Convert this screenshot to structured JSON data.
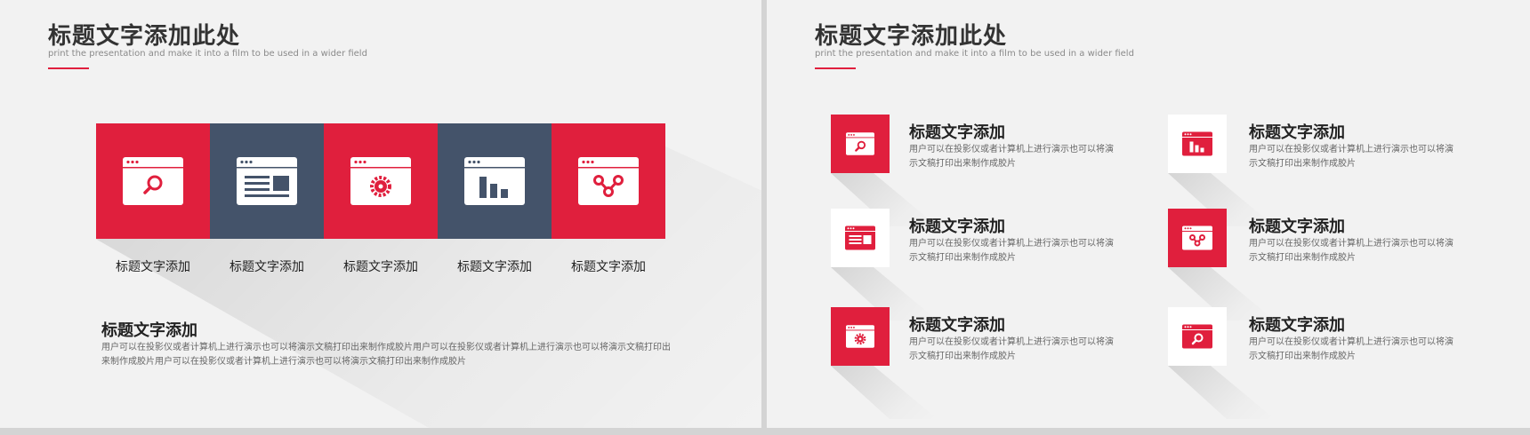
{
  "colors": {
    "accent": "#e01f3d",
    "navy": "#44536a",
    "background": "#f2f2f2"
  },
  "left": {
    "title": "标题文字添加此处",
    "subtitle": "print the presentation and make it into a film to be used in a wider field",
    "blocks": [
      {
        "label": "标题文字添加",
        "icon": "search-window-icon"
      },
      {
        "label": "标题文字添加",
        "icon": "layout-window-icon"
      },
      {
        "label": "标题文字添加",
        "icon": "gear-window-icon"
      },
      {
        "label": "标题文字添加",
        "icon": "bar-chart-window-icon"
      },
      {
        "label": "标题文字添加",
        "icon": "network-window-icon"
      }
    ],
    "paragraph": {
      "title": "标题文字添加",
      "body": "用户可以在投影仪或者计算机上进行演示也可以将演示文稿打印出来制作成胶片用户可以在投影仪或者计算机上进行演示也可以将演示文稿打印出来制作成胶片用户可以在投影仪或者计算机上进行演示也可以将演示文稿打印出来制作成胶片"
    }
  },
  "right": {
    "title": "标题文字添加此处",
    "subtitle": "print the presentation and make it into a film to be used in a wider field",
    "items": [
      {
        "title": "标题文字添加",
        "desc": "用户可以在投影仪或者计算机上进行演示也可以将演示文稿打印出来制作成胶片",
        "icon": "search-window-icon"
      },
      {
        "title": "标题文字添加",
        "desc": "用户可以在投影仪或者计算机上进行演示也可以将演示文稿打印出来制作成胶片",
        "icon": "bar-chart-window-icon"
      },
      {
        "title": "标题文字添加",
        "desc": "用户可以在投影仪或者计算机上进行演示也可以将演示文稿打印出来制作成胶片",
        "icon": "layout-window-icon"
      },
      {
        "title": "标题文字添加",
        "desc": "用户可以在投影仪或者计算机上进行演示也可以将演示文稿打印出来制作成胶片",
        "icon": "network-window-icon"
      },
      {
        "title": "标题文字添加",
        "desc": "用户可以在投影仪或者计算机上进行演示也可以将演示文稿打印出来制作成胶片",
        "icon": "gear-window-icon"
      },
      {
        "title": "标题文字添加",
        "desc": "用户可以在投影仪或者计算机上进行演示也可以将演示文稿打印出来制作成胶片",
        "icon": "search-window-icon"
      }
    ]
  }
}
